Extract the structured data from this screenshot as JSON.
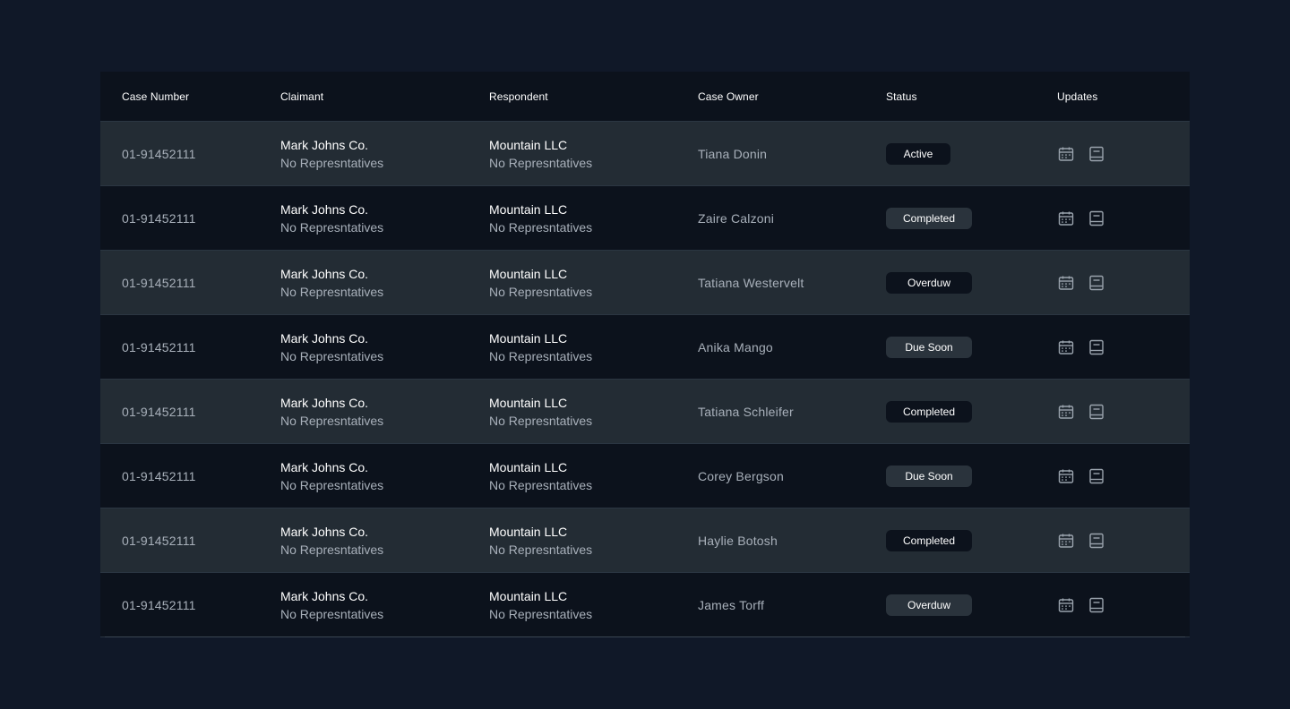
{
  "table": {
    "headers": {
      "case_number": "Case Number",
      "claimant": "Claimant",
      "respondent": "Respondent",
      "case_owner": "Case Owner",
      "status": "Status",
      "updates": "Updates"
    },
    "rows": [
      {
        "case_number": "01-91452111",
        "claimant_name": "Mark Johns Co.",
        "claimant_sub": "No Represntatives",
        "respondent_name": "Mountain LLC",
        "respondent_sub": "No Represntatives",
        "owner": "Tiana Donin",
        "status": "Active"
      },
      {
        "case_number": "01-91452111",
        "claimant_name": "Mark Johns Co.",
        "claimant_sub": "No Represntatives",
        "respondent_name": "Mountain LLC",
        "respondent_sub": "No Represntatives",
        "owner": "Zaire Calzoni",
        "status": "Completed"
      },
      {
        "case_number": "01-91452111",
        "claimant_name": "Mark Johns Co.",
        "claimant_sub": "No Represntatives",
        "respondent_name": "Mountain LLC",
        "respondent_sub": "No Represntatives",
        "owner": "Tatiana Westervelt",
        "status": "Overduw"
      },
      {
        "case_number": "01-91452111",
        "claimant_name": "Mark Johns Co.",
        "claimant_sub": "No Represntatives",
        "respondent_name": "Mountain LLC",
        "respondent_sub": "No Represntatives",
        "owner": "Anika Mango",
        "status": "Due Soon"
      },
      {
        "case_number": "01-91452111",
        "claimant_name": "Mark Johns Co.",
        "claimant_sub": "No Represntatives",
        "respondent_name": "Mountain LLC",
        "respondent_sub": "No Represntatives",
        "owner": "Tatiana Schleifer",
        "status": "Completed"
      },
      {
        "case_number": "01-91452111",
        "claimant_name": "Mark Johns Co.",
        "claimant_sub": "No Represntatives",
        "respondent_name": "Mountain LLC",
        "respondent_sub": "No Represntatives",
        "owner": "Corey Bergson",
        "status": "Due Soon"
      },
      {
        "case_number": "01-91452111",
        "claimant_name": "Mark Johns Co.",
        "claimant_sub": "No Represntatives",
        "respondent_name": "Mountain LLC",
        "respondent_sub": "No Represntatives",
        "owner": "Haylie Botosh",
        "status": "Completed"
      },
      {
        "case_number": "01-91452111",
        "claimant_name": "Mark Johns Co.",
        "claimant_sub": "No Represntatives",
        "respondent_name": "Mountain LLC",
        "respondent_sub": "No Represntatives",
        "owner": "James Torff",
        "status": "Overduw"
      }
    ],
    "update_icons": [
      "calendar-icon",
      "notes-icon"
    ]
  },
  "colors": {
    "page_background": "#101828",
    "row_alt": "#232c34",
    "row_base": "#0c121c",
    "text_primary": "#ffffff",
    "text_secondary": "#a8b0ba",
    "icon": "#9aa3ad"
  }
}
